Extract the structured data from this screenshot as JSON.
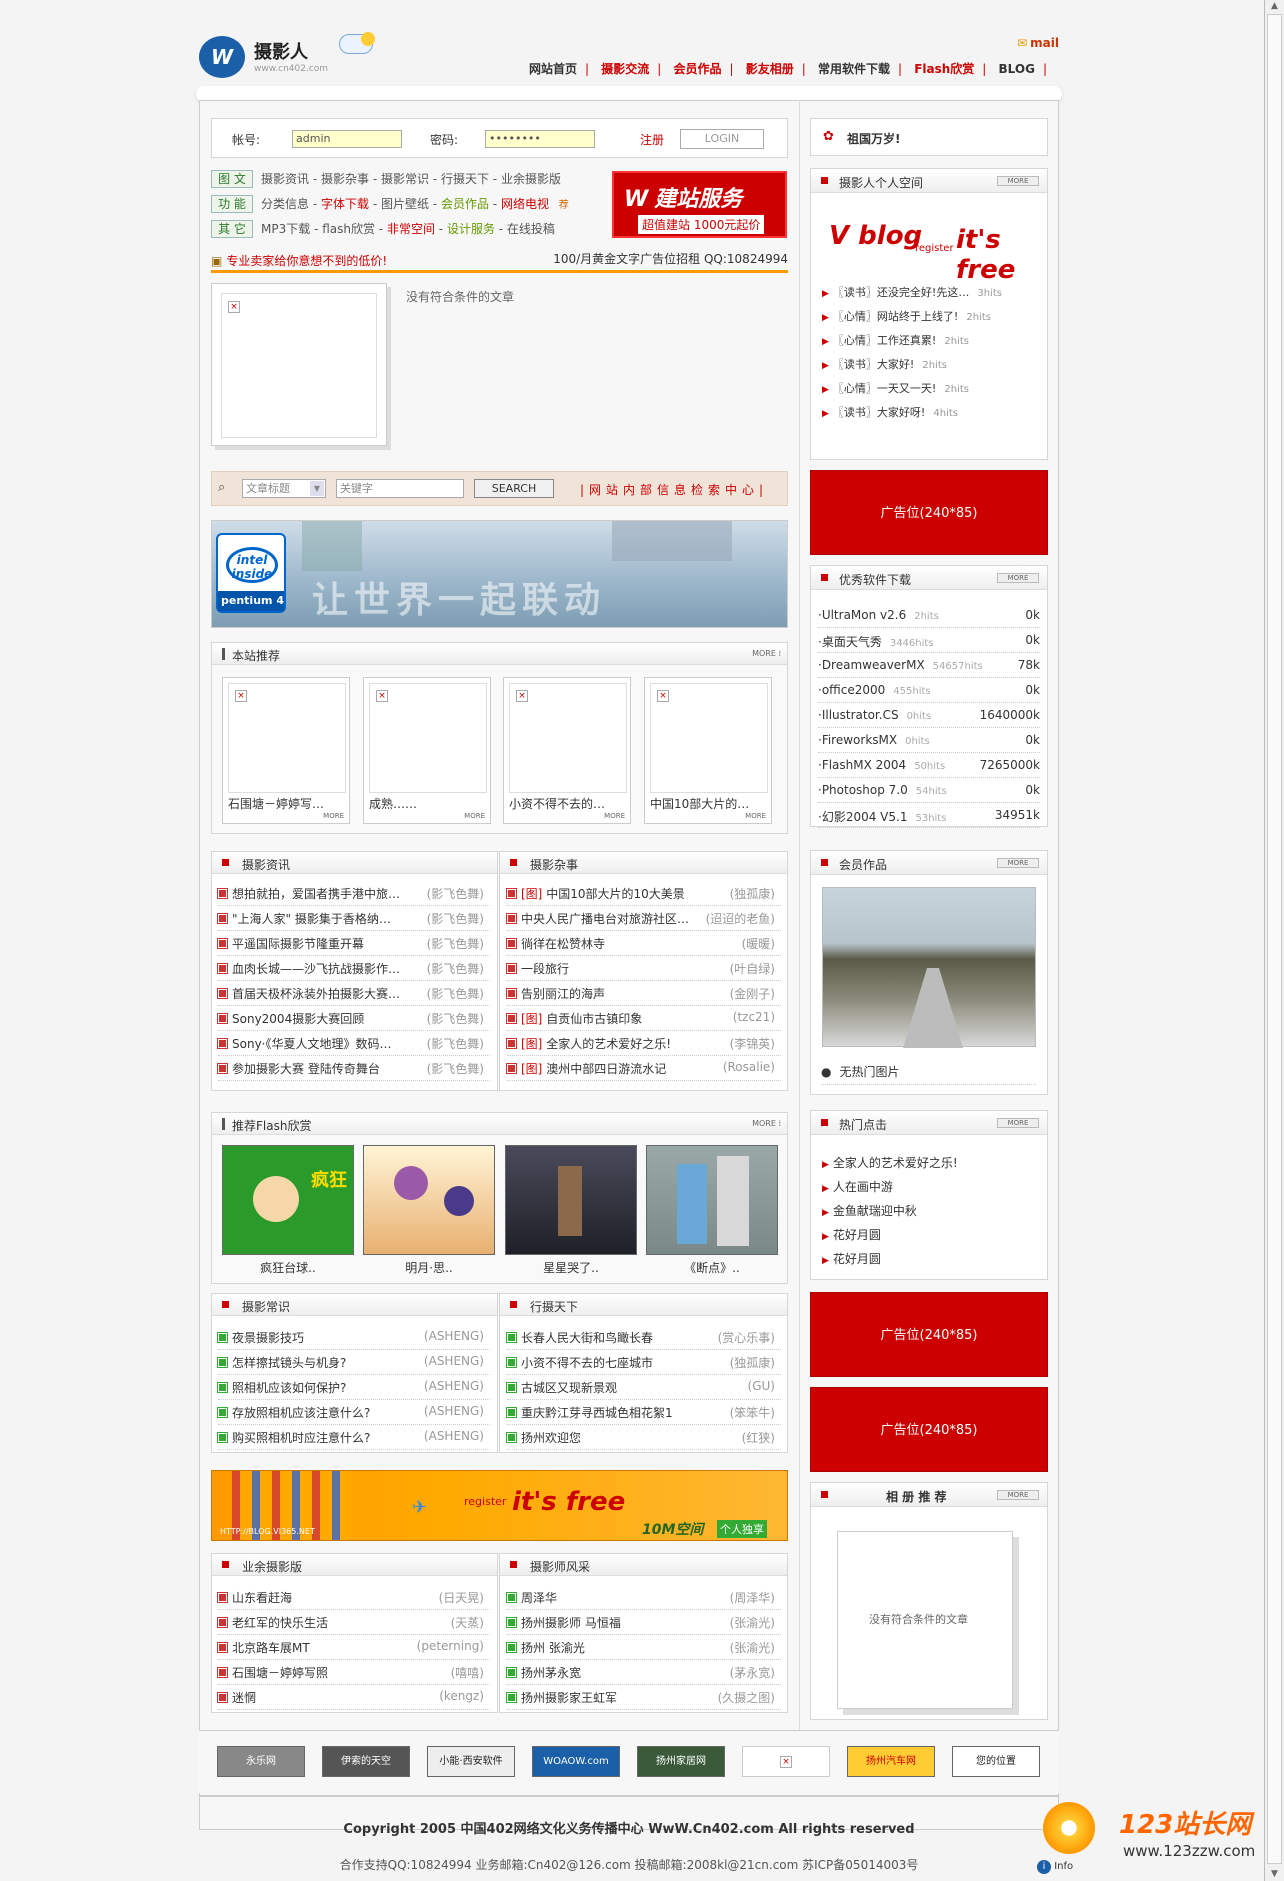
{
  "header": {
    "site_name": "摄影人",
    "site_url": "www.cn402.com",
    "mail": "mail",
    "nav": [
      "网站首页",
      "摄影交流",
      "会员作品",
      "影友相册",
      "常用软件下载",
      "Flash欣赏",
      "BLOG"
    ]
  },
  "login": {
    "account_label": "帐号:",
    "account_value": "admin",
    "password_label": "密码:",
    "password_value": "••••••••",
    "register": "注册",
    "login_button": "LOGIN"
  },
  "categories": [
    {
      "tag": "图 文",
      "items": [
        "摄影资讯",
        "摄影杂事",
        "摄影常识",
        "行摄天下",
        "业余摄影版"
      ]
    },
    {
      "tag": "功 能",
      "items": [
        "分类信息",
        "字体下载",
        "图片壁纸",
        "会员作品",
        "网络电视"
      ],
      "badge": "荐"
    },
    {
      "tag": "其 它",
      "items": [
        "MP3下载",
        "flash欣赏",
        "非常空间",
        "设计服务",
        "在线投稿"
      ]
    }
  ],
  "ad_service": {
    "title": "建站服务",
    "sub": "超值建站  1000元起价"
  },
  "ad_line": {
    "left": "专业卖家给你意想不到的低价!",
    "right": "100/月黄金文字广告位招租 QQ:10824994"
  },
  "no_article": "没有符合条件的文章",
  "search": {
    "select_label": "文章标题",
    "keyword_placeholder": "关键字",
    "button": "SEARCH",
    "center": "|网站内部信息检索中心|"
  },
  "banner": {
    "intel": "intel inside",
    "pentium": "pentium 4",
    "slogan": "让世界一起联动"
  },
  "recommend": {
    "title": "本站推荐",
    "more": "MORE",
    "items": [
      "石围塘－婷婷写…",
      "成熟……",
      "小资不得不去的…",
      "中国10部大片的…"
    ]
  },
  "news": {
    "title": "摄影资讯",
    "items": [
      {
        "t": "想拍就拍，爱国者携手港中旅…",
        "a": "(影飞色舞)"
      },
      {
        "t": "\"上海人家\" 摄影集于香格纳…",
        "a": "(影飞色舞)"
      },
      {
        "t": "平遥国际摄影节隆重开幕",
        "a": "(影飞色舞)"
      },
      {
        "t": "血肉长城——沙飞抗战摄影作…",
        "a": "(影飞色舞)"
      },
      {
        "t": "首届天极杯泳装外拍摄影大赛…",
        "a": "(影飞色舞)"
      },
      {
        "t": "Sony2004摄影大赛回顾",
        "a": "(影飞色舞)"
      },
      {
        "t": "Sony·《华夏人文地理》数码…",
        "a": "(影飞色舞)"
      },
      {
        "t": "参加摄影大赛 登陆传奇舞台",
        "a": "(影飞色舞)"
      }
    ]
  },
  "misc": {
    "title": "摄影杂事",
    "items": [
      {
        "tag": "[图]",
        "t": "中国10部大片的10大美景",
        "a": "(独孤康)"
      },
      {
        "tag": "",
        "t": "中央人民广播电台对旅游社区…",
        "a": "(迢迢的老鱼)"
      },
      {
        "tag": "",
        "t": "徜徉在松赞林寺",
        "a": "(暖暖)"
      },
      {
        "tag": "",
        "t": "一段旅行",
        "a": "(叶自绿)"
      },
      {
        "tag": "",
        "t": "告别丽江的海声",
        "a": "(金刚子)"
      },
      {
        "tag": "[图]",
        "t": "自贡仙市古镇印象",
        "a": "(tzc21)"
      },
      {
        "tag": "[图]",
        "t": "全家人的艺术爱好之乐!",
        "a": "(李锦英)"
      },
      {
        "tag": "[图]",
        "t": "澳州中部四日游流水记",
        "a": "(Rosalie)"
      }
    ]
  },
  "flash": {
    "title": "推荐Flash欣赏",
    "more": "MORE",
    "items": [
      "疯狂台球..",
      "明月·思..",
      "星星哭了..",
      "《断点》.."
    ]
  },
  "common": {
    "title": "摄影常识",
    "items": [
      {
        "t": "夜景摄影技巧",
        "a": "(ASHENG)"
      },
      {
        "t": "怎样擦拭镜头与机身?",
        "a": "(ASHENG)"
      },
      {
        "t": "照相机应该如何保护?",
        "a": "(ASHENG)"
      },
      {
        "t": "存放照相机应该注意什么?",
        "a": "(ASHENG)"
      },
      {
        "t": "购买照相机时应注意什么?",
        "a": "(ASHENG)"
      }
    ]
  },
  "travel": {
    "title": "行摄天下",
    "items": [
      {
        "t": "长春人民大街和鸟瞰长春",
        "a": "(赏心乐事)"
      },
      {
        "t": "小资不得不去的七座城市",
        "a": "(独孤康)"
      },
      {
        "t": "古城区又现新景观",
        "a": "(GU)"
      },
      {
        "t": "重庆黔江芽寻西城色相花絮1",
        "a": "(笨笨牛)"
      },
      {
        "t": "扬州欢迎您",
        "a": "(红狭)"
      }
    ]
  },
  "orange_ad": {
    "register": "register",
    "free": "it's free",
    "url": "HTTP://BLOG.VI365.NET",
    "space": "10M空间",
    "personal": "个人独享"
  },
  "amateur": {
    "title": "业余摄影版",
    "items": [
      {
        "t": "山东看赶海",
        "a": "(日天晃)"
      },
      {
        "t": "老红军的快乐生活",
        "a": "(天蒸)"
      },
      {
        "t": "北京路车展MT",
        "a": "(peterning)"
      },
      {
        "t": "石围塘－婷婷写照",
        "a": "(嘻嘻)"
      },
      {
        "t": "迷惘",
        "a": "(kengz)"
      }
    ]
  },
  "photographer": {
    "title": "摄影师风采",
    "items": [
      {
        "t": "周泽华",
        "a": "(周泽华)"
      },
      {
        "t": "扬州摄影师 马恒福",
        "a": "(张渝光)"
      },
      {
        "t": "扬州 张渝光",
        "a": "(张渝光)"
      },
      {
        "t": "扬州茅永宽",
        "a": "(茅永宽)"
      },
      {
        "t": "扬州摄影家王虹军",
        "a": "(久摄之图)"
      }
    ]
  },
  "right": {
    "motherland": "祖国万岁!",
    "personal_space": {
      "title": "摄影人个人空间",
      "more": "MORE",
      "vblog": "V blog",
      "register": "register",
      "free": "it's free",
      "items": [
        {
          "t": "〖读书〗还没完全好!先这…",
          "h": "3hits"
        },
        {
          "t": "〖心情〗网站终于上线了!",
          "h": "2hits"
        },
        {
          "t": "〖心情〗工作还真累!",
          "h": "2hits"
        },
        {
          "t": "〖读书〗大家好!",
          "h": "2hits"
        },
        {
          "t": "〖心情〗一天又一天!",
          "h": "2hits"
        },
        {
          "t": "〖读书〗大家好呀!",
          "h": "4hits"
        }
      ]
    },
    "ad_label": "广告位(240*85)",
    "software": {
      "title": "优秀软件下载",
      "more": "MORE",
      "items": [
        {
          "n": "·UltraMon v2.6",
          "h": "2hits",
          "v": "0k"
        },
        {
          "n": "·桌面天气秀",
          "h": "3446hits",
          "v": "0k"
        },
        {
          "n": "·DreamweaverMX",
          "h": "54657hits",
          "v": "78k"
        },
        {
          "n": "·office2000",
          "h": "455hits",
          "v": "0k"
        },
        {
          "n": "·Illustrator.CS",
          "h": "0hits",
          "v": "1640000k"
        },
        {
          "n": "·FireworksMX",
          "h": "0hits",
          "v": "0k"
        },
        {
          "n": "·FlashMX 2004",
          "h": "50hits",
          "v": "7265000k"
        },
        {
          "n": "·Photoshop 7.0",
          "h": "54hits",
          "v": "0k"
        },
        {
          "n": "·幻影2004 V5.1",
          "h": "53hits",
          "v": "34951k"
        }
      ]
    },
    "member_works": {
      "title": "会员作品",
      "more": "MORE",
      "no_hot": "无热门图片"
    },
    "hot_click": {
      "title": "热门点击",
      "more": "MORE",
      "items": [
        "全家人的艺术爱好之乐!",
        "人在画中游",
        "金鱼献瑞迎中秋",
        "花好月圆",
        "花好月圆"
      ]
    },
    "album": {
      "title": "相 册 推 荐",
      "more": "MORE",
      "no_article": "没有符合条件的文章"
    }
  },
  "footer_links": [
    "永乐网",
    "伊索的天空",
    "小能·西安软件",
    "WOAOW.com",
    "扬州家居网",
    "",
    "扬州汽车网",
    "您的位置"
  ],
  "copyright": "Copyright 2005 中国402网络文化义务传播中心 WwW.Cn402.com All rights reserved",
  "contact": "合作支持QQ:10824994  业务邮箱:Cn402@126.com  投稿邮箱:2008kl@21cn.com 苏ICP备05014003号",
  "watermark": {
    "brand": "123站长网",
    "url": "www.123zzw.com",
    "info": "Info"
  },
  "colors": {
    "accent_red": "#cc0000",
    "orange": "#ff9900",
    "link_green": "#669900"
  }
}
